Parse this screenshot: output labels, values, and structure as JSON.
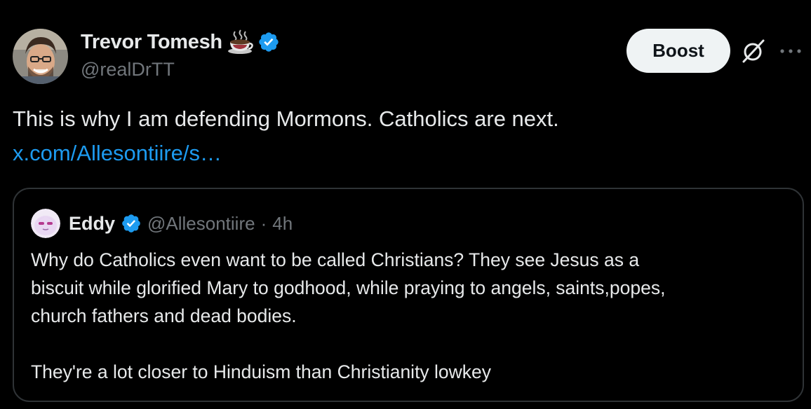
{
  "post": {
    "author": {
      "name": "Trevor Tomesh",
      "handle": "@realDrTT",
      "name_emoji": "coffee-cup-icon",
      "verified": true
    },
    "actions": {
      "boost_label": "Boost",
      "grok_icon": "grok-icon",
      "more_icon": "more-horizontal-icon"
    },
    "text": "This is why I am defending Mormons. Catholics are next.",
    "link": "x.com/Allesontiire/s…"
  },
  "quote": {
    "author": {
      "name": "Eddy",
      "handle": "@Allesontiire",
      "separator": "·",
      "time": "4h",
      "verified": true
    },
    "lines": [
      "Why do Catholics even want to be called Christians?  They see Jesus as a",
      "biscuit while glorified Mary to godhood, while praying to angels, saints,popes,",
      "church fathers and dead bodies."
    ],
    "closing_line": "They're a lot closer to Hinduism than Christianity lowkey"
  },
  "colors": {
    "background": "#000000",
    "text_primary": "#e7e9ea",
    "text_secondary": "#71767b",
    "link": "#1d9bf0",
    "verified": "#1d9bf0",
    "card_border": "#2f3336",
    "button_bg": "#eff3f4",
    "button_text": "#0f1419"
  }
}
